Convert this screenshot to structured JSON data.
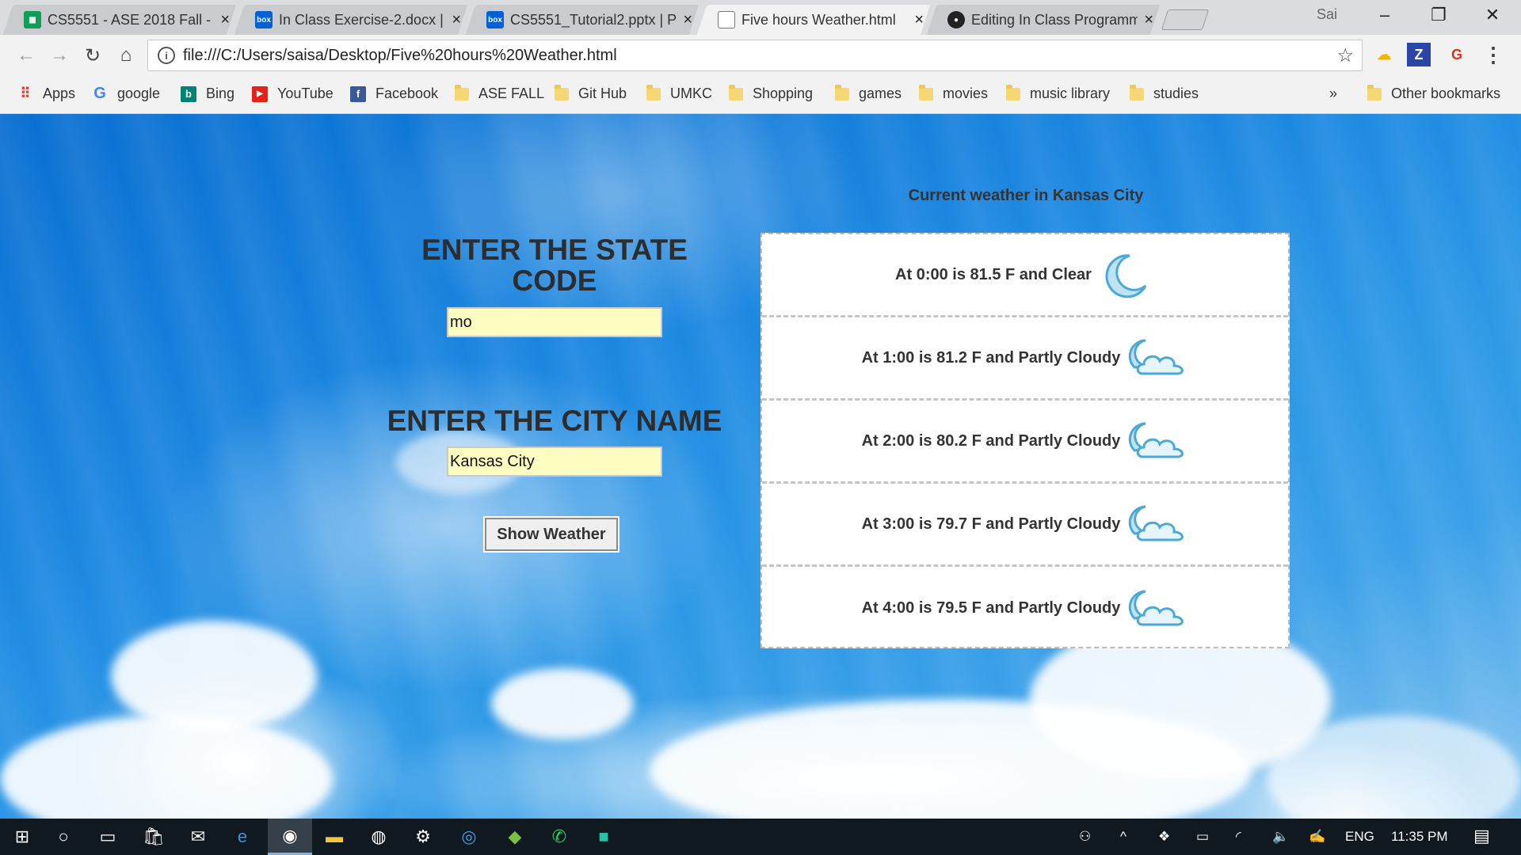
{
  "browser": {
    "tabs": [
      {
        "title": "CS5551 - ASE 2018 Fall - ",
        "favicon": "sheets-icon",
        "color": "#0f9d58",
        "active": false
      },
      {
        "title": "In Class Exercise-2.docx | ",
        "favicon": "box-icon",
        "color": "#0061d5",
        "active": false
      },
      {
        "title": "CS5551_Tutorial2.pptx | P",
        "favicon": "box-icon",
        "color": "#0061d5",
        "active": false
      },
      {
        "title": "Five hours Weather.html",
        "favicon": "page-icon",
        "color": "#666666",
        "active": true
      },
      {
        "title": "Editing In Class Programm",
        "favicon": "github-icon",
        "color": "#222222",
        "active": false
      }
    ],
    "profile_name": "Sai",
    "url": "file:///C:/Users/saisa/Desktop/Five%20hours%20Weather.html",
    "bookmarks": [
      {
        "label": "Apps",
        "icon": "apps-grid-icon"
      },
      {
        "label": "google",
        "icon": "google-icon"
      },
      {
        "label": "Bing",
        "icon": "bing-icon"
      },
      {
        "label": "YouTube",
        "icon": "youtube-icon"
      },
      {
        "label": "Facebook",
        "icon": "facebook-icon"
      },
      {
        "label": "ASE FALL",
        "icon": "folder-icon"
      },
      {
        "label": "Git Hub",
        "icon": "folder-icon"
      },
      {
        "label": "UMKC",
        "icon": "folder-icon"
      },
      {
        "label": "Shopping",
        "icon": "folder-icon"
      },
      {
        "label": "games",
        "icon": "folder-icon"
      },
      {
        "label": "movies",
        "icon": "folder-icon"
      },
      {
        "label": "music library",
        "icon": "folder-icon"
      },
      {
        "label": "studies",
        "icon": "folder-icon"
      }
    ],
    "more_bookmarks": "»",
    "other_bookmarks": "Other bookmarks"
  },
  "page": {
    "state_heading": "ENTER THE STATE CODE",
    "state_value": "mo",
    "city_heading": "ENTER THE CITY NAME",
    "city_value": "Kansas City",
    "button_label": "Show Weather",
    "weather_heading": "Current weather in Kansas City",
    "forecast": [
      {
        "text": "At 0:00 is 81.5 F and Clear",
        "icon": "moon-icon"
      },
      {
        "text": "At 1:00 is 81.2 F and Partly Cloudy",
        "icon": "partly-cloudy-night-icon"
      },
      {
        "text": "At 2:00 is 80.2 F and Partly Cloudy",
        "icon": "partly-cloudy-night-icon"
      },
      {
        "text": "At 3:00 is 79.7 F and Partly Cloudy",
        "icon": "partly-cloudy-night-icon"
      },
      {
        "text": "At 4:00 is 79.5 F and Partly Cloudy",
        "icon": "partly-cloudy-night-icon"
      }
    ]
  },
  "taskbar": {
    "language": "ENG",
    "time": "11:35 PM"
  }
}
